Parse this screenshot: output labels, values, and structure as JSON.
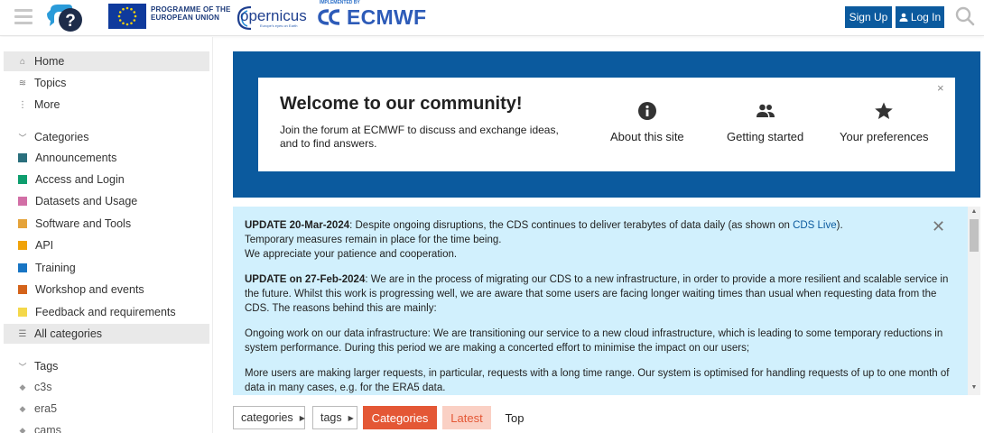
{
  "header": {
    "eu_text_line1": "PROGRAMME OF THE",
    "eu_text_line2": "EUROPEAN UNION",
    "copernicus_name": "opernicus",
    "copernicus_tagline": "Europe's eyes on Earth",
    "implemented_by": "IMPLEMENTED BY",
    "ecmwf_name": "ECMWF",
    "signup_label": "Sign Up",
    "login_label": "Log In"
  },
  "sidebar": {
    "nav": [
      {
        "label": "Home",
        "icon": "home-icon"
      },
      {
        "label": "Topics",
        "icon": "topics-icon"
      },
      {
        "label": "More",
        "icon": "more-icon"
      }
    ],
    "categories_header": "Categories",
    "categories": [
      {
        "label": "Announcements",
        "color": "#2a6f7d"
      },
      {
        "label": "Access and Login",
        "color": "#0e9e6e"
      },
      {
        "label": "Datasets and Usage",
        "color": "#d26fa6"
      },
      {
        "label": "Software and Tools",
        "color": "#e5a33a"
      },
      {
        "label": "API",
        "color": "#f0a30a"
      },
      {
        "label": "Training",
        "color": "#1875c4"
      },
      {
        "label": "Workshop and events",
        "color": "#d4631a"
      },
      {
        "label": "Feedback and requirements",
        "color": "#f4d84a"
      }
    ],
    "all_categories": "All categories",
    "tags_header": "Tags",
    "tags": [
      "c3s",
      "era5",
      "cams"
    ]
  },
  "welcome": {
    "title": "Welcome to our community!",
    "description": "Join the forum at ECMWF to discuss and exchange ideas, and to find answers.",
    "close": "×",
    "links": [
      {
        "label": "About this site",
        "icon": "info-icon"
      },
      {
        "label": "Getting started",
        "icon": "users-icon"
      },
      {
        "label": "Your preferences",
        "icon": "star-icon"
      }
    ]
  },
  "notice": {
    "close": "✕",
    "p1_bold": "UPDATE 20-Mar-2024",
    "p1_text": ": Despite ongoing disruptions, the CDS continues to deliver terabytes of data daily (as shown on ",
    "p1_link": "CDS Live",
    "p1_end": ").",
    "p1_line2": "Temporary measures remain in place for the time being.",
    "p1_line3": "We appreciate your patience and cooperation.",
    "p2_bold": "UPDATE on 27-Feb-2024",
    "p2_text": ": We are in the process of migrating our CDS to a new infrastructure, in order to provide a more resilient and scalable service in the future. Whilst this work is progressing well, we are aware that some users are facing longer waiting times than usual when requesting data from the CDS. The reasons behind this are mainly:",
    "p3_text": "Ongoing work on our data infrastructure: We are transitioning our service to a new cloud infrastructure, which is leading to some temporary reductions in system performance. During this period we are making a concerted effort to minimise the impact on our users;",
    "p4_text": "More users are making larger requests, in particular, requests with a long time range. Our system is optimised for handling requests of up to one month of data in many cases, e.g. for the ERA5 data."
  },
  "filters": {
    "categories_label": "categories",
    "tags_label": "tags",
    "tabs": [
      "Categories",
      "Latest",
      "Top"
    ]
  }
}
